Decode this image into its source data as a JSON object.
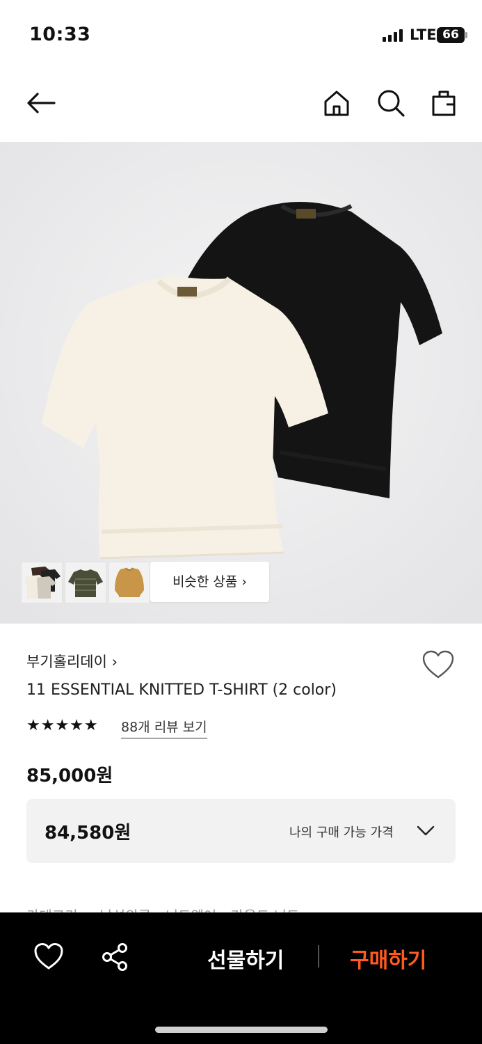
{
  "status_bar": {
    "time": "10:33",
    "network": "LTE",
    "battery": "66"
  },
  "header": {
    "icons": [
      "back-arrow-icon",
      "home-icon",
      "search-icon",
      "shopping-bag-icon"
    ]
  },
  "product_image": {
    "description_icons": [
      "cream-knit-tshirt",
      "black-knit-tshirt"
    ],
    "similar_products_label": "비슷한 상품 ›"
  },
  "product": {
    "brand": "부기홀리데이 ›",
    "title": "11 ESSENTIAL KNITTED T-SHIRT (2 color)",
    "rating_stars": "★★★★★",
    "rating": 5,
    "review_link": "88개 리뷰 보기",
    "price": "85,000원",
    "my_price": "84,580원",
    "my_price_label": "나의 구매 가능 가격",
    "category_partial": "카테고리 · · 남성의류 › 니트웨어 › 라운드 니트"
  },
  "bottom_bar": {
    "gift_label": "선물하기",
    "buy_label": "구매하기",
    "accent_color": "#ff5a1f"
  }
}
